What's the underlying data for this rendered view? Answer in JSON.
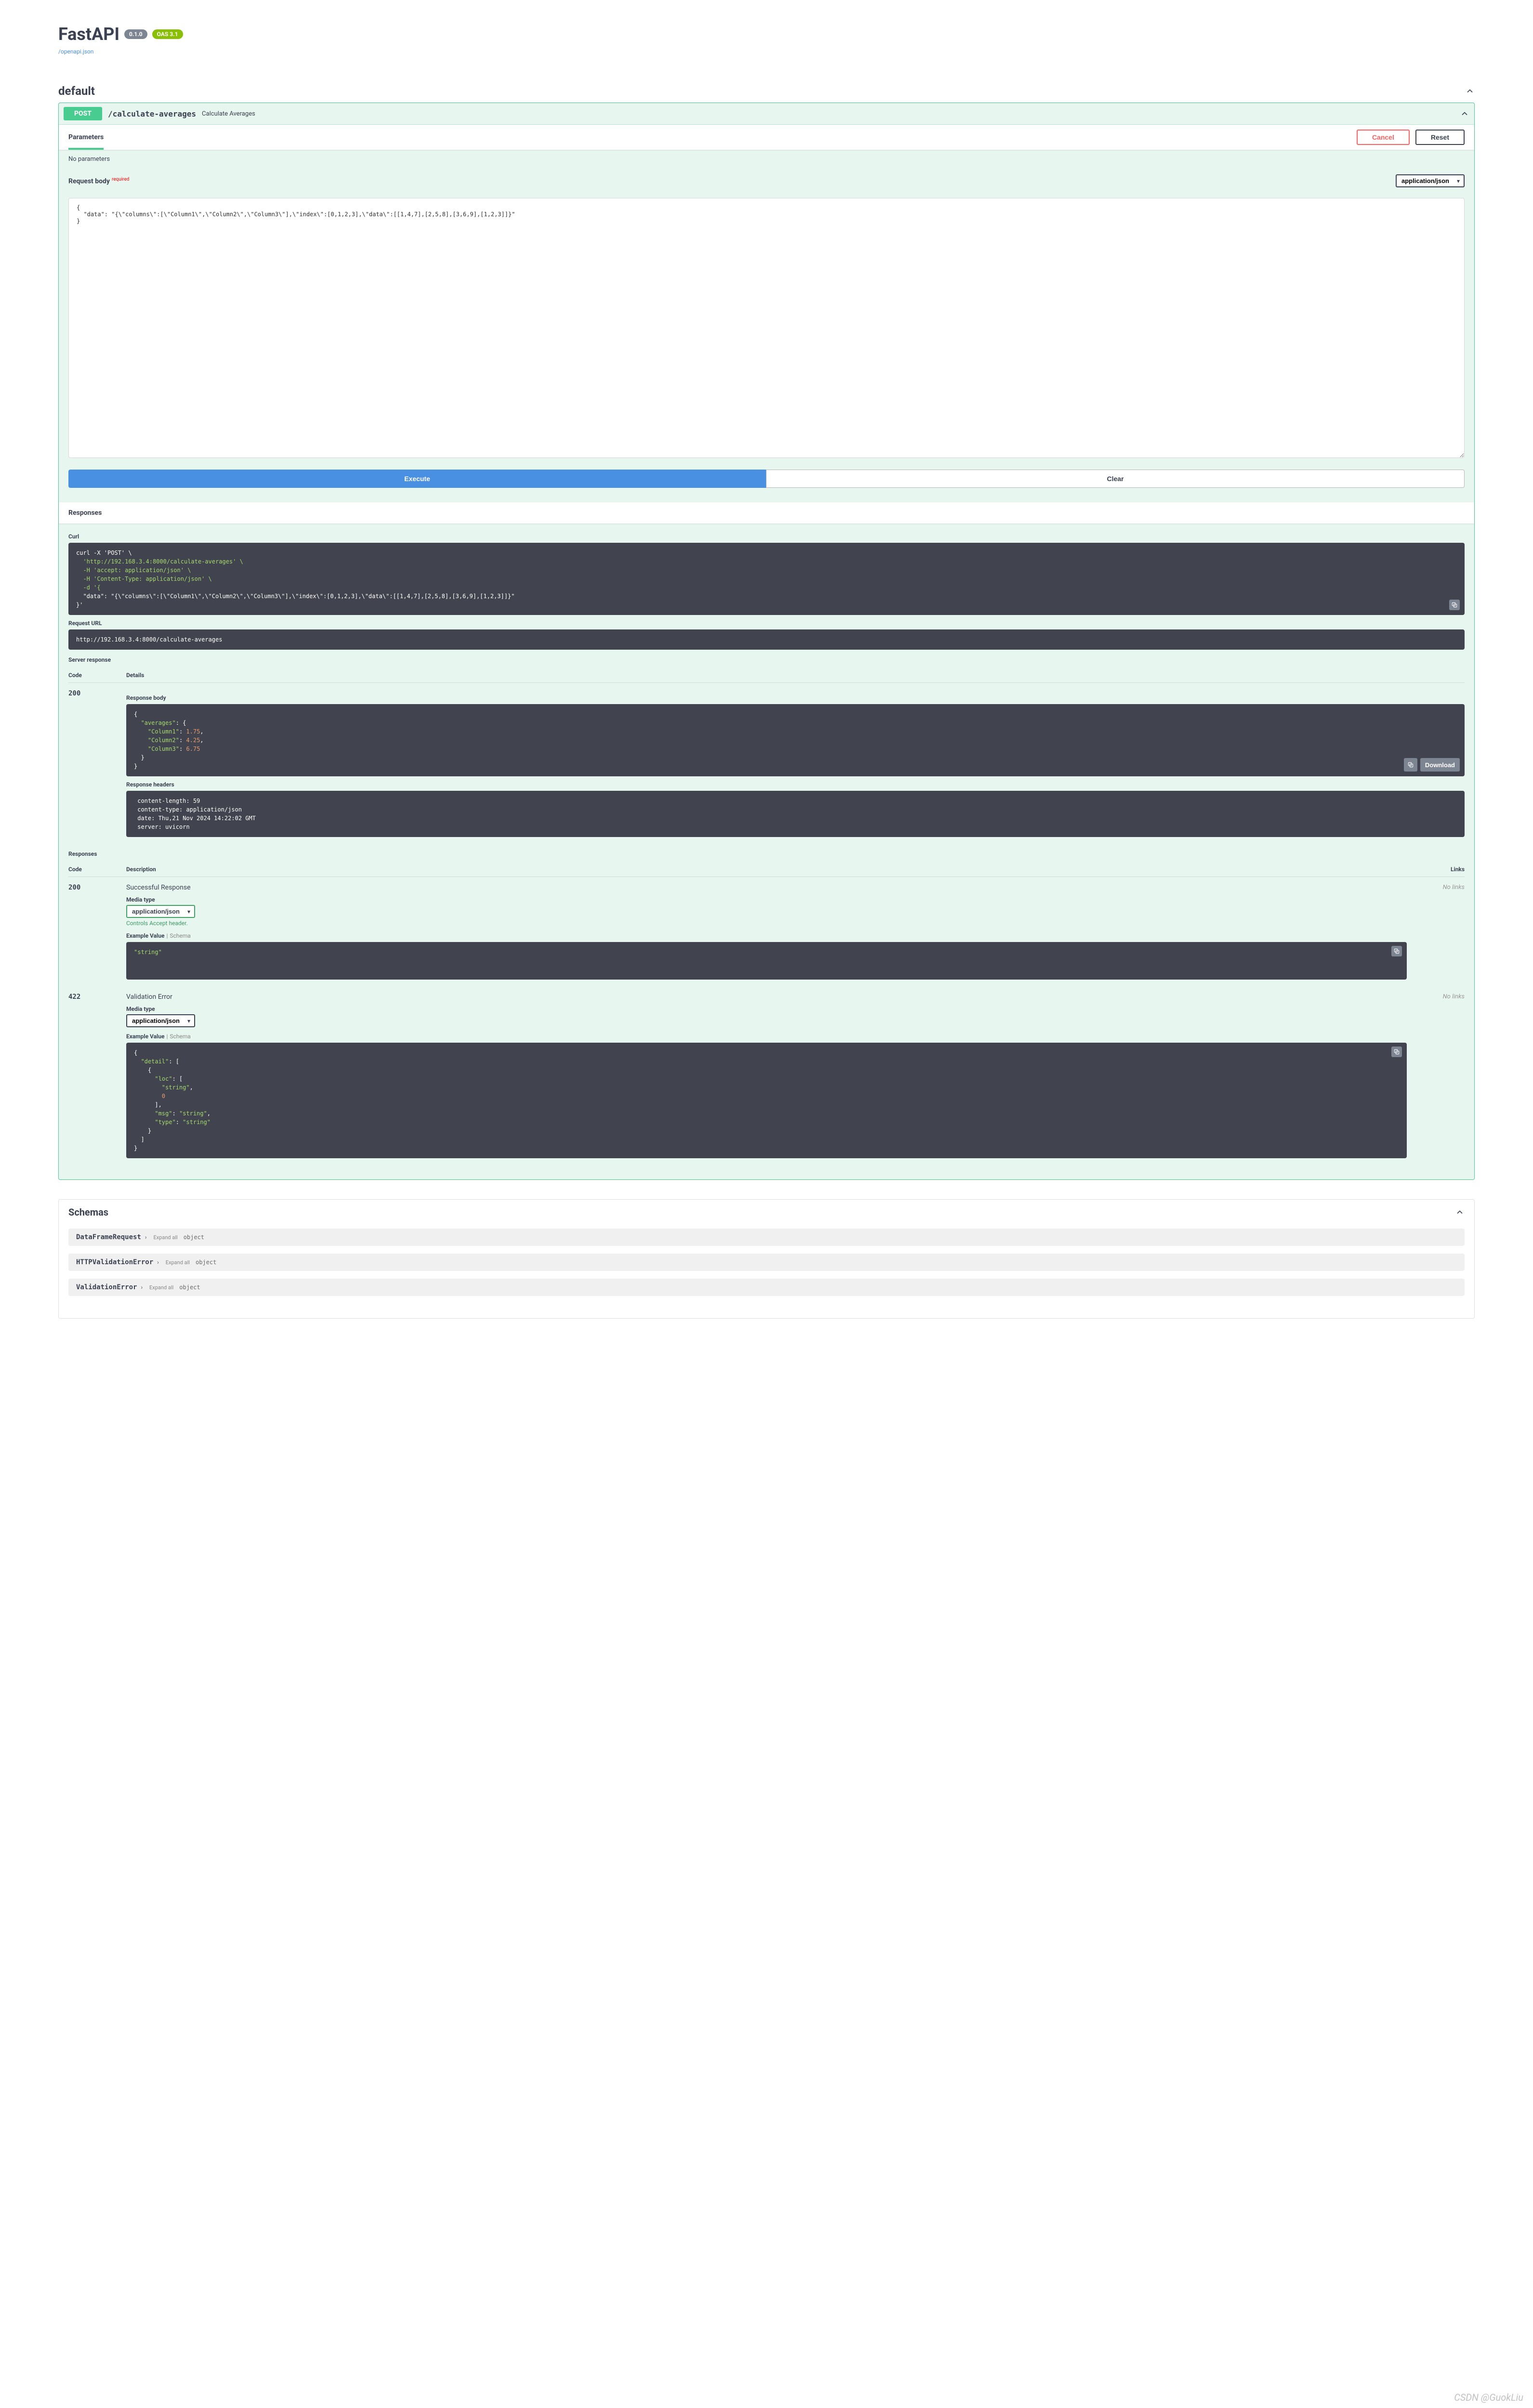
{
  "header": {
    "title": "FastAPI",
    "version_badge": "0.1.0",
    "oas_badge": "OAS 3.1",
    "openapi_link": "/openapi.json"
  },
  "section_default": {
    "title": "default"
  },
  "op": {
    "method": "POST",
    "path": "/calculate-averages",
    "summary": "Calculate Averages",
    "tab_parameters": "Parameters",
    "btn_cancel": "Cancel",
    "btn_reset": "Reset",
    "no_params": "No parameters",
    "req_body_label": "Request body",
    "req_body_required": "required",
    "content_type": "application/json",
    "body_value": "{\n  \"data\": \"{\\\"columns\\\":[\\\"Column1\\\",\\\"Column2\\\",\\\"Column3\\\"],\\\"index\\\":[0,1,2,3],\\\"data\\\":[[1,4,7],[2,5,8],[3,6,9],[1,2,3]]}\"\n}",
    "btn_execute": "Execute",
    "btn_clear": "Clear"
  },
  "responses": {
    "title": "Responses",
    "curl_label": "Curl",
    "curl_lines": [
      "curl -X 'POST' \\",
      "  'http://192.168.3.4:8000/calculate-averages' \\",
      "  -H 'accept: application/json' \\",
      "  -H 'Content-Type: application/json' \\",
      "  -d '{",
      "  \"data\": \"{\\\"columns\\\":[\\\"Column1\\\",\\\"Column2\\\",\\\"Column3\\\"],\\\"index\\\":[0,1,2,3],\\\"data\\\":[[1,4,7],[2,5,8],[3,6,9],[1,2,3]]}\"",
      "}'"
    ],
    "request_url_label": "Request URL",
    "request_url": "http://192.168.3.4:8000/calculate-averages",
    "server_response_label": "Server response",
    "col_code": "Code",
    "col_details": "Details",
    "col_desc": "Description",
    "col_links": "Links",
    "live": {
      "code": "200",
      "body_label": "Response body",
      "body_lines": [
        "{",
        "  \"averages\": {",
        "    \"Column1\": 1.75,",
        "    \"Column2\": 4.25,",
        "    \"Column3\": 6.75",
        "  }",
        "}"
      ],
      "headers_label": "Response headers",
      "headers": " content-length: 59 \n content-type: application/json \n date: Thu,21 Nov 2024 14:22:02 GMT \n server: uvicorn ",
      "download": "Download"
    },
    "responses_label": "Responses",
    "doc200": {
      "code": "200",
      "desc": "Successful Response",
      "media_label": "Media type",
      "media": "application/json",
      "accept_hint": "Controls Accept header.",
      "example_label": "Example Value",
      "schema_label": "Schema",
      "example": "\"string\"",
      "no_links": "No links"
    },
    "doc422": {
      "code": "422",
      "desc": "Validation Error",
      "media_label": "Media type",
      "media": "application/json",
      "example_label": "Example Value",
      "schema_label": "Schema",
      "example_lines": [
        "{",
        "  \"detail\": [",
        "    {",
        "      \"loc\": [",
        "        \"string\",",
        "        0",
        "      ],",
        "      \"msg\": \"string\",",
        "      \"type\": \"string\"",
        "    }",
        "  ]",
        "}"
      ],
      "no_links": "No links"
    }
  },
  "schemas": {
    "title": "Schemas",
    "expand_all": "Expand all",
    "object": "object",
    "items": [
      {
        "name": "DataFrameRequest"
      },
      {
        "name": "HTTPValidationError"
      },
      {
        "name": "ValidationError"
      }
    ]
  },
  "watermark": "CSDN @GuokLiu"
}
